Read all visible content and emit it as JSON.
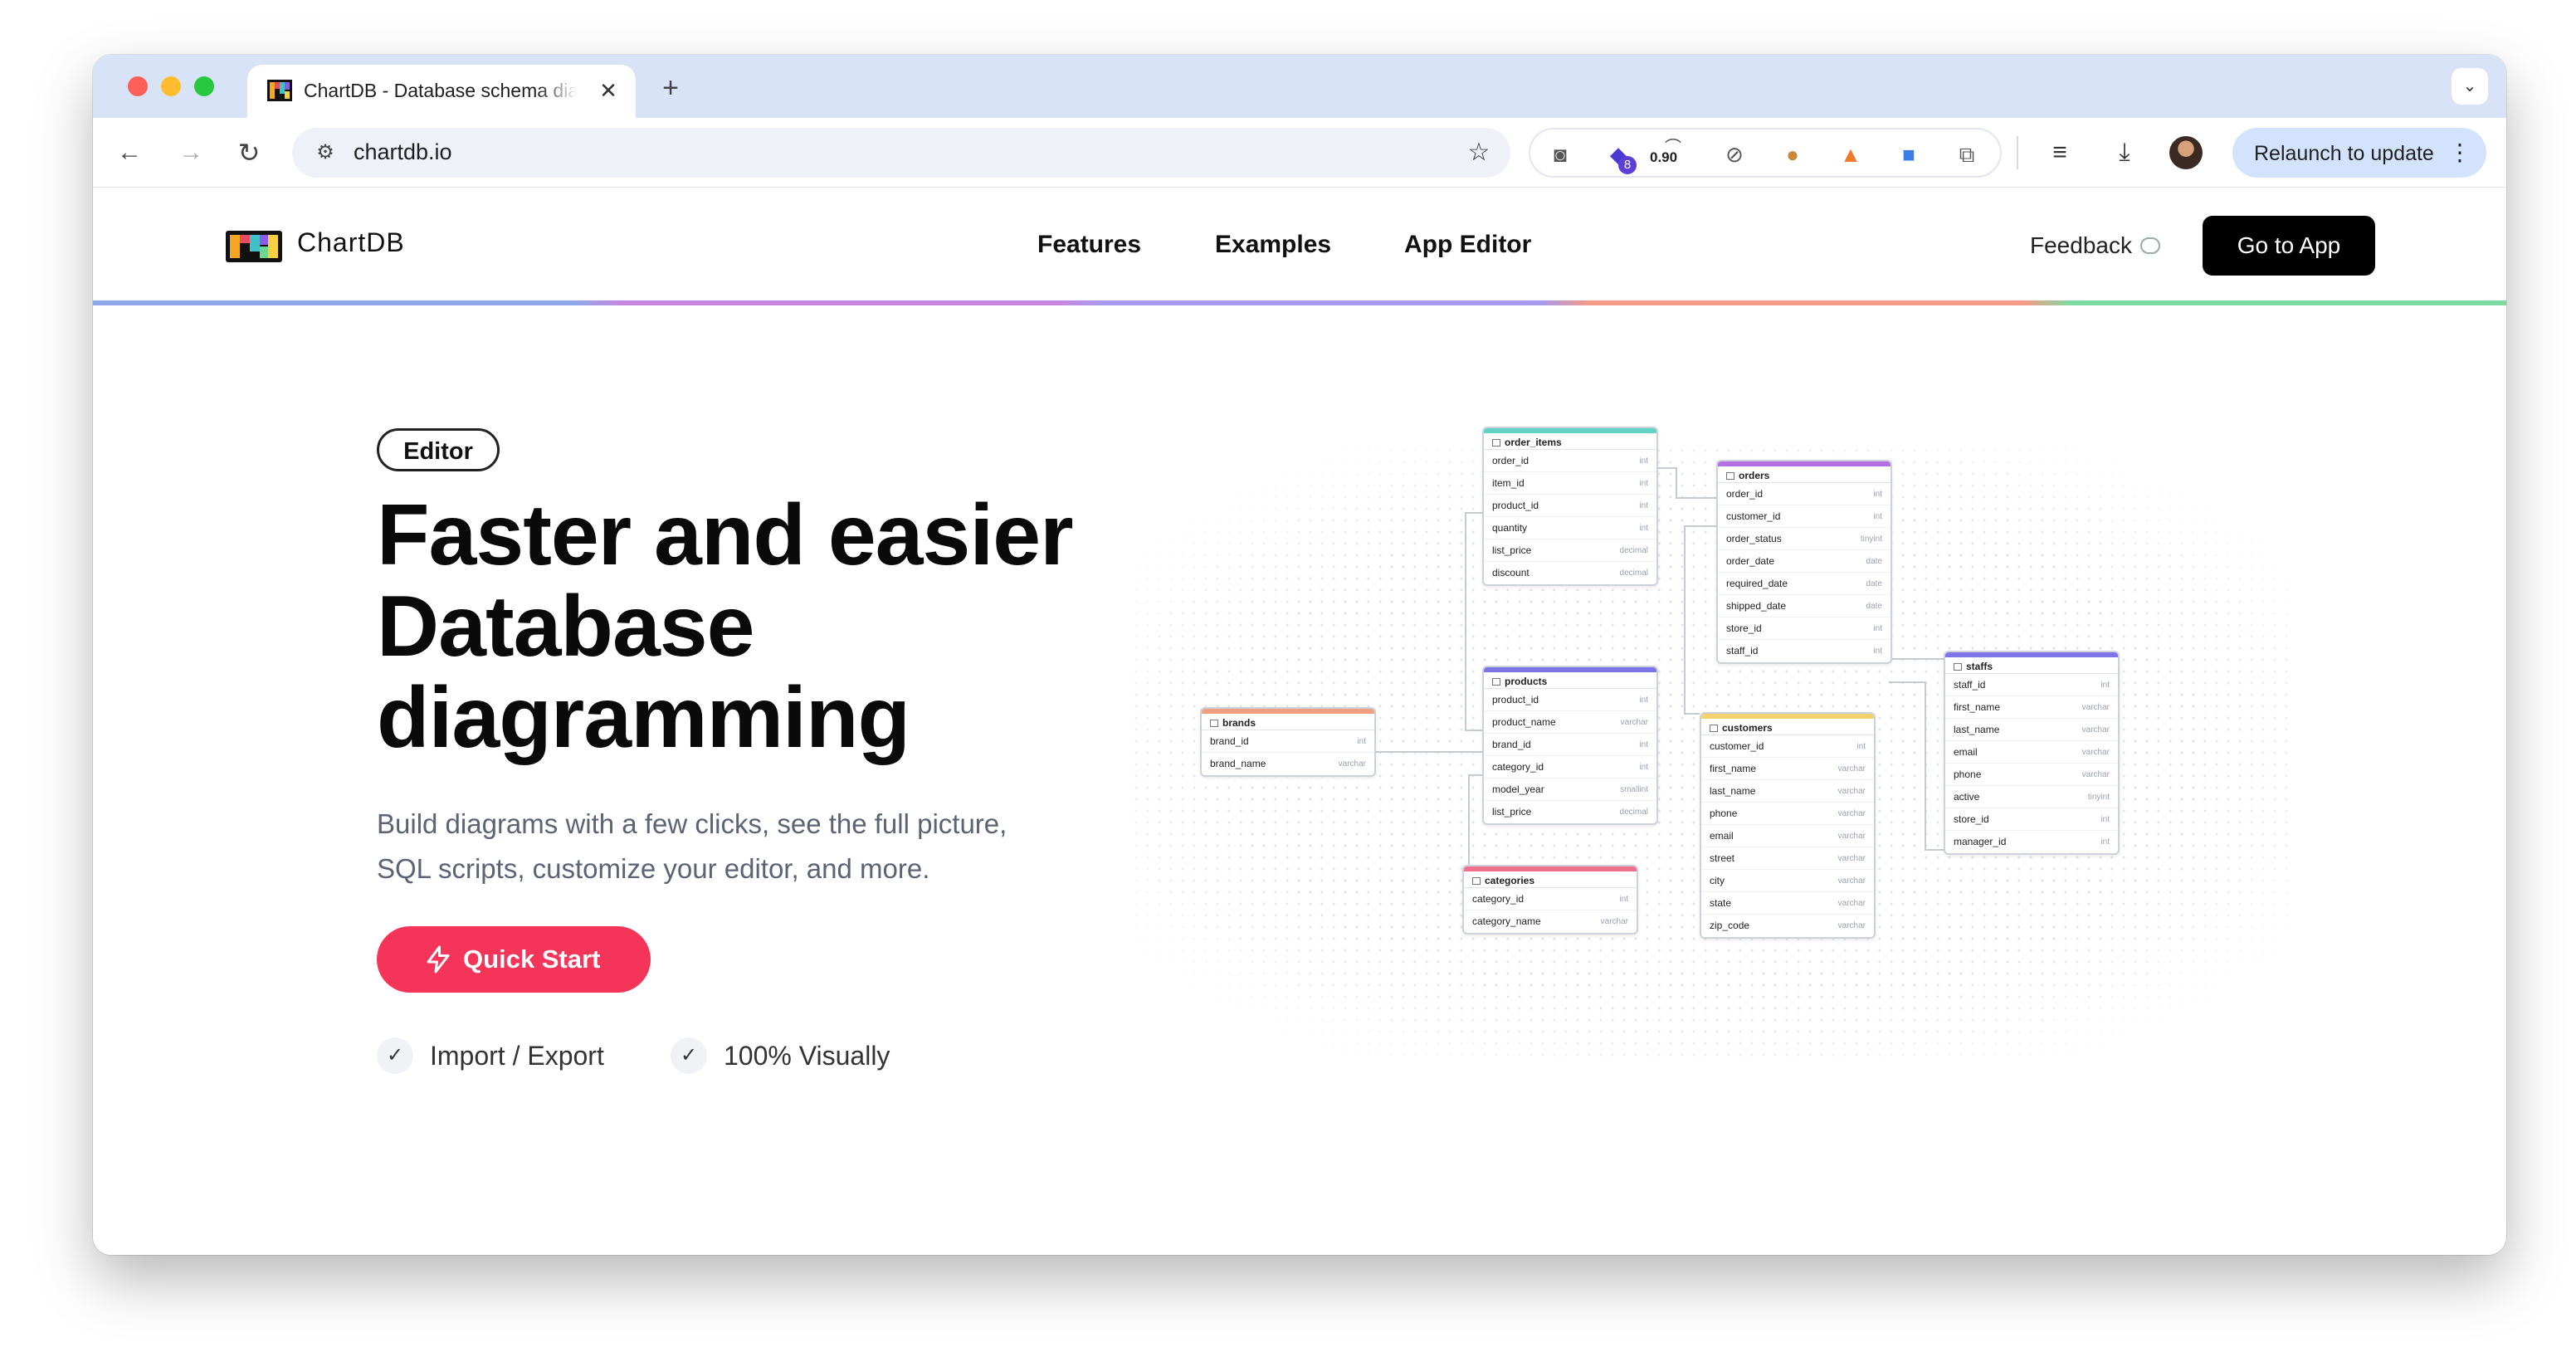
{
  "browser": {
    "tab_title": "ChartDB - Database schema diagrams visualizer",
    "tab_close": "✕",
    "new_tab": "+",
    "tab_search": "⌄",
    "url": "chartdb.io",
    "extension_badge": "8",
    "extension_zoom": "0.90",
    "relaunch_label": "Relaunch to update",
    "relaunch_menu": "⋮"
  },
  "header": {
    "brand": "ChartDB",
    "nav": [
      {
        "label": "Features"
      },
      {
        "label": "Examples"
      },
      {
        "label": "App Editor"
      }
    ],
    "feedback": "Feedback",
    "cta": "Go to App"
  },
  "hero": {
    "badge": "Editor",
    "title_lines": [
      "Faster and easier",
      "Database",
      "diagramming"
    ],
    "subtitle_lines": [
      "Build diagrams with a few clicks, see the full picture,",
      "SQL scripts, customize your editor, and more."
    ],
    "cta": "Quick Start",
    "features": [
      "Import / Export",
      "100% Visually"
    ]
  },
  "diagram": {
    "tables": [
      {
        "name": "order_items",
        "color": "#5fd3c4",
        "columns": [
          {
            "name": "order_id",
            "type": "int"
          },
          {
            "name": "item_id",
            "type": "int"
          },
          {
            "name": "product_id",
            "type": "int"
          },
          {
            "name": "quantity",
            "type": "int"
          },
          {
            "name": "list_price",
            "type": "decimal"
          },
          {
            "name": "discount",
            "type": "decimal"
          }
        ]
      },
      {
        "name": "orders",
        "color": "#b46fe3",
        "columns": [
          {
            "name": "order_id",
            "type": "int"
          },
          {
            "name": "customer_id",
            "type": "int"
          },
          {
            "name": "order_status",
            "type": "tinyint"
          },
          {
            "name": "order_date",
            "type": "date"
          },
          {
            "name": "required_date",
            "type": "date"
          },
          {
            "name": "shipped_date",
            "type": "date"
          },
          {
            "name": "store_id",
            "type": "int"
          },
          {
            "name": "staff_id",
            "type": "int"
          }
        ]
      },
      {
        "name": "products",
        "color": "#7c74e8",
        "columns": [
          {
            "name": "product_id",
            "type": "int"
          },
          {
            "name": "product_name",
            "type": "varchar"
          },
          {
            "name": "brand_id",
            "type": "int"
          },
          {
            "name": "category_id",
            "type": "int"
          },
          {
            "name": "model_year",
            "type": "smallint"
          },
          {
            "name": "list_price",
            "type": "decimal"
          }
        ]
      },
      {
        "name": "brands",
        "color": "#f0a07e",
        "columns": [
          {
            "name": "brand_id",
            "type": "int"
          },
          {
            "name": "brand_name",
            "type": "varchar"
          }
        ]
      },
      {
        "name": "categories",
        "color": "#f06f8c",
        "columns": [
          {
            "name": "category_id",
            "type": "int"
          },
          {
            "name": "category_name",
            "type": "varchar"
          }
        ]
      },
      {
        "name": "customers",
        "color": "#f2d36b",
        "columns": [
          {
            "name": "customer_id",
            "type": "int"
          },
          {
            "name": "first_name",
            "type": "varchar"
          },
          {
            "name": "last_name",
            "type": "varchar"
          },
          {
            "name": "phone",
            "type": "varchar"
          },
          {
            "name": "email",
            "type": "varchar"
          },
          {
            "name": "street",
            "type": "varchar"
          },
          {
            "name": "city",
            "type": "varchar"
          },
          {
            "name": "state",
            "type": "varchar"
          },
          {
            "name": "zip_code",
            "type": "varchar"
          }
        ]
      },
      {
        "name": "staffs",
        "color": "#7c74e8",
        "columns": [
          {
            "name": "staff_id",
            "type": "int"
          },
          {
            "name": "first_name",
            "type": "varchar"
          },
          {
            "name": "last_name",
            "type": "varchar"
          },
          {
            "name": "email",
            "type": "varchar"
          },
          {
            "name": "phone",
            "type": "varchar"
          },
          {
            "name": "active",
            "type": "tinyint"
          },
          {
            "name": "store_id",
            "type": "int"
          },
          {
            "name": "manager_id",
            "type": "int"
          }
        ]
      }
    ]
  },
  "colors": {
    "accent": "#f5345a",
    "cta_dark": "#000000",
    "tab_strip": "#d8e3f8"
  }
}
